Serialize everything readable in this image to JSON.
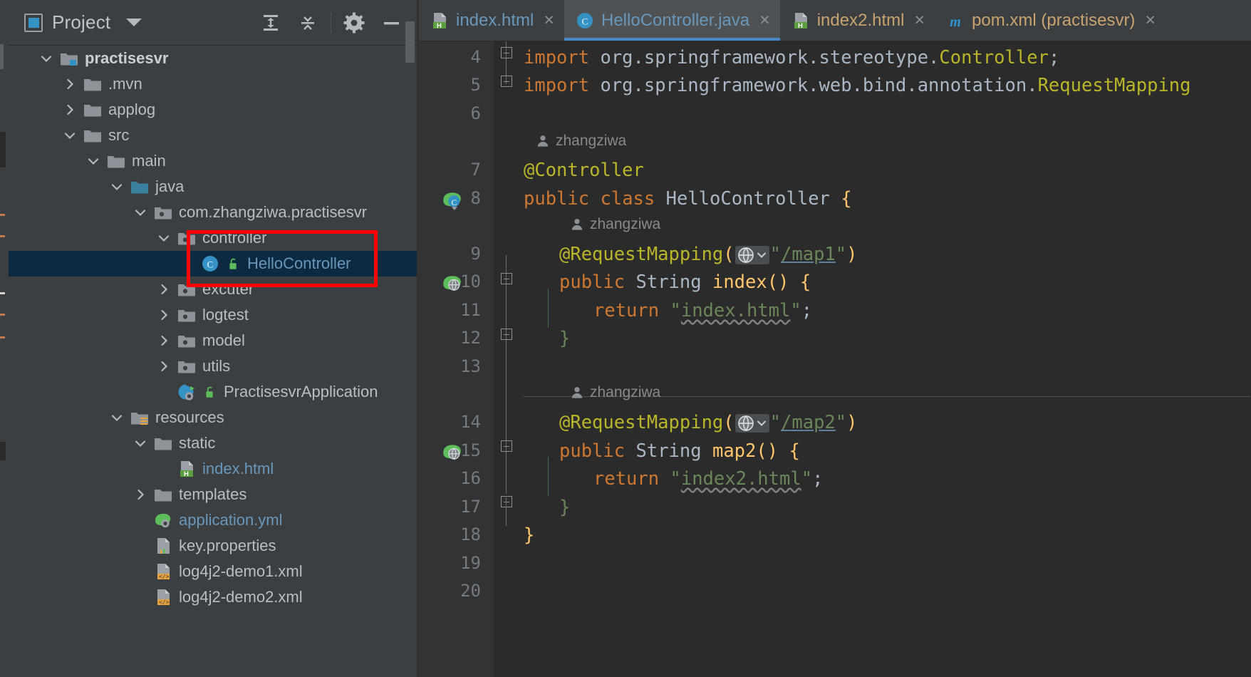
{
  "window": {
    "theme_bg": "#3c3f41",
    "editor_bg": "#2b2b2b",
    "accent": "#4a88c7",
    "selection_bg": "#0d2a40",
    "annotation_color": "#ff0000"
  },
  "project_panel": {
    "title": "Project",
    "icons": {
      "project": "project-window-icon",
      "dropdown": "chevron-down-icon",
      "expand_all": "expand-all-icon",
      "collapse_all": "collapse-all-icon",
      "settings": "gear-icon",
      "hide": "minimize-icon"
    },
    "tree": [
      {
        "label": "practisesvr",
        "indent": 0,
        "twisty": "expanded",
        "icon": "module-folder-icon",
        "style": "bold"
      },
      {
        "label": ".mvn",
        "indent": 1,
        "twisty": "collapsed",
        "icon": "folder-icon",
        "style": "normal"
      },
      {
        "label": "applog",
        "indent": 1,
        "twisty": "collapsed",
        "icon": "folder-icon",
        "style": "normal"
      },
      {
        "label": "src",
        "indent": 1,
        "twisty": "expanded",
        "icon": "folder-icon",
        "style": "normal"
      },
      {
        "label": "main",
        "indent": 2,
        "twisty": "expanded",
        "icon": "folder-icon",
        "style": "normal"
      },
      {
        "label": "java",
        "indent": 3,
        "twisty": "expanded",
        "icon": "source-root-icon",
        "style": "normal"
      },
      {
        "label": "com.zhangziwa.practisesvr",
        "indent": 4,
        "twisty": "expanded",
        "icon": "package-icon",
        "style": "normal"
      },
      {
        "label": "controller",
        "indent": 5,
        "twisty": "expanded",
        "icon": "package-icon",
        "style": "normal"
      },
      {
        "label": "HelloController",
        "indent": 6,
        "twisty": "none",
        "icon": "java-class-icon",
        "style": "file-blue",
        "selected": true
      },
      {
        "label": "excuter",
        "indent": 5,
        "twisty": "collapsed",
        "icon": "package-icon",
        "style": "normal"
      },
      {
        "label": "logtest",
        "indent": 5,
        "twisty": "collapsed",
        "icon": "package-icon",
        "style": "normal"
      },
      {
        "label": "model",
        "indent": 5,
        "twisty": "collapsed",
        "icon": "package-icon",
        "style": "normal"
      },
      {
        "label": "utils",
        "indent": 5,
        "twisty": "collapsed",
        "icon": "package-icon",
        "style": "normal"
      },
      {
        "label": "PractisesvrApplication",
        "indent": 5,
        "twisty": "none",
        "icon": "spring-boot-app-icon",
        "style": "normal"
      },
      {
        "label": "resources",
        "indent": 3,
        "twisty": "expanded",
        "icon": "resource-root-icon",
        "style": "normal"
      },
      {
        "label": "static",
        "indent": 4,
        "twisty": "expanded",
        "icon": "folder-icon",
        "style": "normal"
      },
      {
        "label": "index.html",
        "indent": 5,
        "twisty": "none",
        "icon": "html-file-icon",
        "style": "file-blue"
      },
      {
        "label": "templates",
        "indent": 4,
        "twisty": "collapsed",
        "icon": "folder-icon",
        "style": "normal"
      },
      {
        "label": "application.yml",
        "indent": 4,
        "twisty": "none",
        "icon": "spring-yaml-icon",
        "style": "file-blue"
      },
      {
        "label": "key.properties",
        "indent": 4,
        "twisty": "none",
        "icon": "properties-file-icon",
        "style": "normal"
      },
      {
        "label": "log4j2-demo1.xml",
        "indent": 4,
        "twisty": "none",
        "icon": "xml-file-icon",
        "style": "normal"
      },
      {
        "label": "log4j2-demo2.xml",
        "indent": 4,
        "twisty": "none",
        "icon": "xml-file-icon",
        "style": "normal"
      }
    ]
  },
  "editor": {
    "tabs": [
      {
        "label": "index.html",
        "icon": "html-file-icon",
        "active": false,
        "color": "blue",
        "closable": true
      },
      {
        "label": "HelloController.java",
        "icon": "java-class-icon",
        "active": true,
        "color": "blue",
        "closable": true
      },
      {
        "label": "index2.html",
        "icon": "html-file-icon",
        "active": false,
        "color": "orange",
        "closable": true
      },
      {
        "label": "pom.xml (practisesvr)",
        "icon": "maven-icon",
        "active": false,
        "color": "orange",
        "closable": true
      }
    ],
    "close_glyph": "×",
    "line_numbers": [
      "4",
      "5",
      "6",
      "7",
      "8",
      "9",
      "10",
      "11",
      "12",
      "13",
      "14",
      "15",
      "16",
      "17",
      "18",
      "19",
      "20"
    ],
    "vcs_author": "zhangziwa",
    "code_lines": [
      {
        "num": "4",
        "text": "import org.springframework.stereotype.Controller;"
      },
      {
        "num": "5",
        "text": "import org.springframework.web.bind.annotation.RequestMapping"
      },
      {
        "num": "6",
        "text": ""
      },
      {
        "num": "7",
        "text": "@Controller"
      },
      {
        "num": "8",
        "text": "public class HelloController {"
      },
      {
        "num": "9",
        "text": "    @RequestMapping(\"/map1\")"
      },
      {
        "num": "10",
        "text": "    public String index() {"
      },
      {
        "num": "11",
        "text": "        return \"index.html\";"
      },
      {
        "num": "12",
        "text": "    }"
      },
      {
        "num": "13",
        "text": ""
      },
      {
        "num": "14",
        "text": "    @RequestMapping(\"/map2\")"
      },
      {
        "num": "15",
        "text": "    public String map2() {"
      },
      {
        "num": "16",
        "text": "        return \"index2.html\";"
      },
      {
        "num": "17",
        "text": "    }"
      },
      {
        "num": "18",
        "text": "}"
      },
      {
        "num": "19",
        "text": ""
      },
      {
        "num": "20",
        "text": ""
      }
    ],
    "tokens": {
      "kw_import": "import",
      "pkg1": " org.springframework.stereotype.",
      "cls1": "Controller",
      "semi": ";",
      "pkg2": " org.springframework.web.bind.annotation.",
      "cls2": "RequestMapping",
      "ann_controller": "@Controller",
      "kw_public": "public",
      "kw_class": "class",
      "cls_hello": "HelloController",
      "brace_open": "{",
      "brace_close": "}",
      "ann_requestmapping": "@RequestMapping",
      "paren_open": "(",
      "paren_close": ")",
      "quote": "\"",
      "url_map1": "/map1",
      "url_map2": "/map2",
      "type_string": "String",
      "method_index": "index",
      "method_map2": "map2",
      "empty_parens": "()",
      "kw_return": "return",
      "str_index_html": "index.html",
      "str_index2_html": "index2.html"
    },
    "gutter_marks": [
      {
        "line": "8",
        "icon": "spring-bean-icon"
      },
      {
        "line": "10",
        "icon": "spring-mapping-icon"
      },
      {
        "line": "15",
        "icon": "spring-mapping-icon"
      }
    ],
    "inlay_icons": {
      "globe": "globe-icon",
      "chevron": "chevron-down-icon",
      "author": "person-icon"
    }
  }
}
